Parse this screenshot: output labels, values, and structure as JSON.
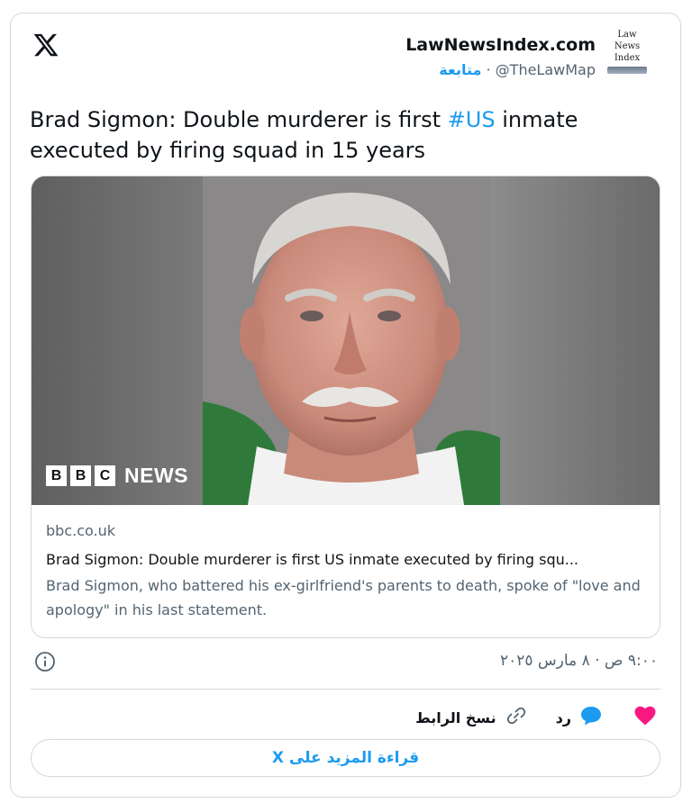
{
  "header": {
    "author_name": "LawNewsIndex.com",
    "author_handle": "@TheLawMap",
    "separator": " · ",
    "follow_label": "متابعة",
    "avatar_lines": [
      "Law",
      "News",
      "Index"
    ]
  },
  "tweet": {
    "text_before": "Brad Sigmon: Double murderer is first ",
    "hashtag": "#US",
    "text_after": " inmate executed by firing squad in 15 years"
  },
  "link_card": {
    "brand_letters": [
      "B",
      "B",
      "C"
    ],
    "brand_news": "NEWS",
    "domain": "bbc.co.uk",
    "title": "Brad Sigmon: Double murderer is first US inmate executed by firing squ...",
    "description": "Brad Sigmon, who battered his ex-girlfriend's parents to death, spoke of \"love and apology\" in his last statement."
  },
  "meta": {
    "timestamp": "٩:٠٠ ص · ٨ مارس ٢٠٢٥"
  },
  "actions": {
    "reply_label": "رد",
    "copy_link_label": "نسخ الرابط"
  },
  "read_more_label": "قراءة المزيد على X",
  "colors": {
    "accent": "#1d9bf0",
    "like": "#f91880",
    "border": "#cfd9de",
    "muted": "#536471"
  },
  "icons": {
    "logo": "x-logo-icon",
    "info": "info-icon",
    "like": "heart-icon",
    "reply": "reply-bubble-icon",
    "copy": "link-icon"
  }
}
